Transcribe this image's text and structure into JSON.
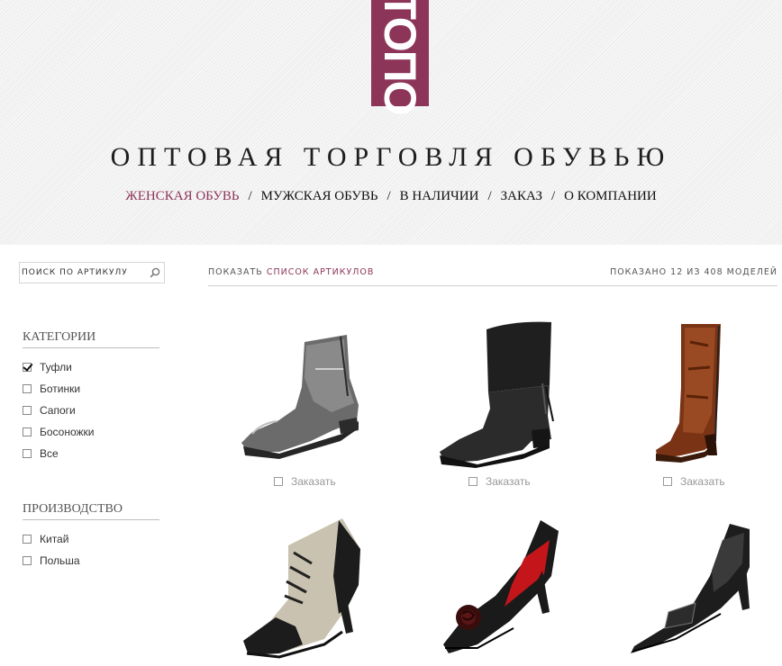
{
  "logo": {
    "text": "ТОПО"
  },
  "site_title": "ОПТОВАЯ ТОРГОВЛЯ ОБУВЬЮ",
  "nav": {
    "items": [
      {
        "label": "ЖЕНСКАЯ ОБУВЬ",
        "active": true
      },
      {
        "label": "МУЖСКАЯ ОБУВЬ",
        "active": false
      },
      {
        "label": "В НАЛИЧИИ",
        "active": false
      },
      {
        "label": "ЗАКАЗ",
        "active": false
      },
      {
        "label": "О КОМПАНИИ",
        "active": false
      }
    ],
    "separator": "/"
  },
  "search": {
    "placeholder": "ПОИСК ПО АРТИКУЛУ",
    "icon": "search-icon"
  },
  "categories": {
    "title": "КАТЕГОРИИ",
    "items": [
      {
        "label": "Туфли",
        "checked": true
      },
      {
        "label": "Ботинки",
        "checked": false
      },
      {
        "label": "Сапоги",
        "checked": false
      },
      {
        "label": "Босоножки",
        "checked": false
      },
      {
        "label": "Все",
        "checked": false
      }
    ]
  },
  "production": {
    "title": "ПРОИЗВОДСТВО",
    "items": [
      {
        "label": "Китай",
        "checked": false
      },
      {
        "label": "Польша",
        "checked": false
      }
    ]
  },
  "toolbar": {
    "show_prefix": "ПОКАЗАТЬ",
    "show_link": "СПИСОК АРТИКУЛОВ",
    "count_text": "ПОКАЗАНО 12 ИЗ 408 МОДЕЛЕЙ"
  },
  "products": [
    {
      "name": "grey-leather-ankle-boot",
      "order_label": "Заказать"
    },
    {
      "name": "black-suede-folded-boot",
      "order_label": "Заказать"
    },
    {
      "name": "brown-tall-boot",
      "order_label": "Заказать"
    },
    {
      "name": "lace-up-oxford-pump",
      "order_label": "Заказать"
    },
    {
      "name": "black-pump-with-rose",
      "order_label": "Заказать"
    },
    {
      "name": "black-pointed-pump",
      "order_label": "Заказать"
    }
  ],
  "colors": {
    "accent": "#8c3559",
    "text": "#222222",
    "muted": "#999999"
  }
}
